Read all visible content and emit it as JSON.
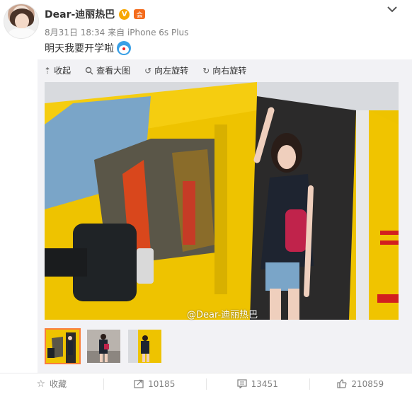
{
  "header": {
    "username": "Dear-迪丽热巴",
    "verified_badge": "V",
    "member_badge": "会",
    "date": "8月31日 18:34",
    "source": "来自 iPhone 6s Plus",
    "menu_icon": "chevron-down-icon"
  },
  "post": {
    "text": "明天我要开学啦"
  },
  "toolbar": {
    "collapse_label": "收起",
    "view_large_label": "查看大图",
    "rotate_left_label": "向左旋转",
    "rotate_right_label": "向右旋转"
  },
  "photo": {
    "watermark": "@Dear-迪丽热巴"
  },
  "thumbnails": [
    {
      "active": true
    },
    {
      "active": false
    },
    {
      "active": false
    }
  ],
  "actions": {
    "favorite_label": "收藏",
    "repost_count": "10185",
    "comment_count": "13451",
    "like_count": "210859"
  },
  "colors": {
    "accent_orange": "#fa7d3c",
    "van_yellow": "#f2c200",
    "verify_gold": "#f7a700"
  }
}
